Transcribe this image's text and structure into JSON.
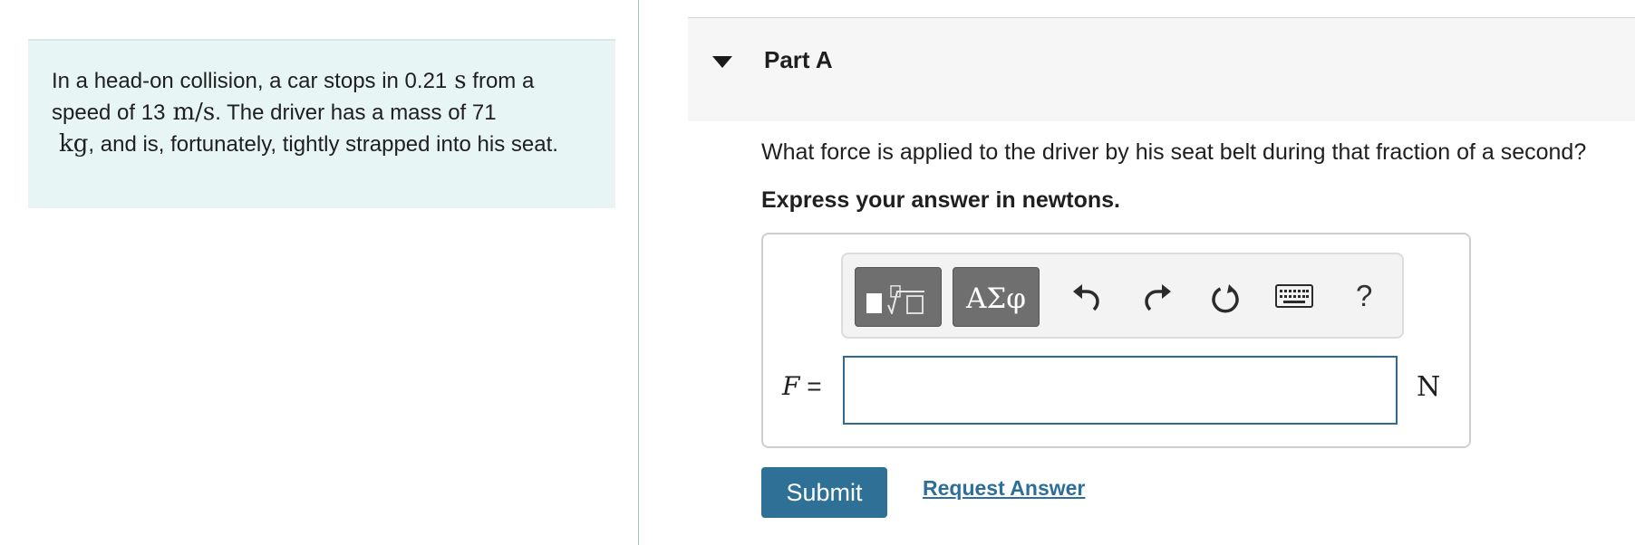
{
  "problem": {
    "text_1": "In a head-on collision, a car stops in 0.21",
    "unit_time": "s",
    "text_2": "from a speed of 13",
    "unit_speed": "m/s",
    "text_3": ". The driver has a mass of 71",
    "unit_mass": "kg",
    "text_4": ", and is, fortunately, tightly strapped into his seat."
  },
  "part": {
    "title": "Part A",
    "question": "What force is applied to the driver by his seat belt during that fraction of a second?",
    "instruction": "Express your answer in newtons."
  },
  "toolbar": {
    "greek_label": "ΑΣφ",
    "help_label": "?",
    "icons": [
      "templates-icon",
      "undo-icon",
      "redo-icon",
      "reset-icon",
      "keyboard-icon",
      "help-icon"
    ]
  },
  "answer": {
    "variable": "F",
    "equals": "=",
    "value": "",
    "unit": "N"
  },
  "actions": {
    "submit_label": "Submit",
    "request_label": "Request Answer"
  },
  "colors": {
    "problem_bg": "#e8f5f5",
    "header_bg": "#f6f6f6",
    "primary": "#2f7196",
    "link": "#2d6f99",
    "input_border": "#2e6a93"
  }
}
